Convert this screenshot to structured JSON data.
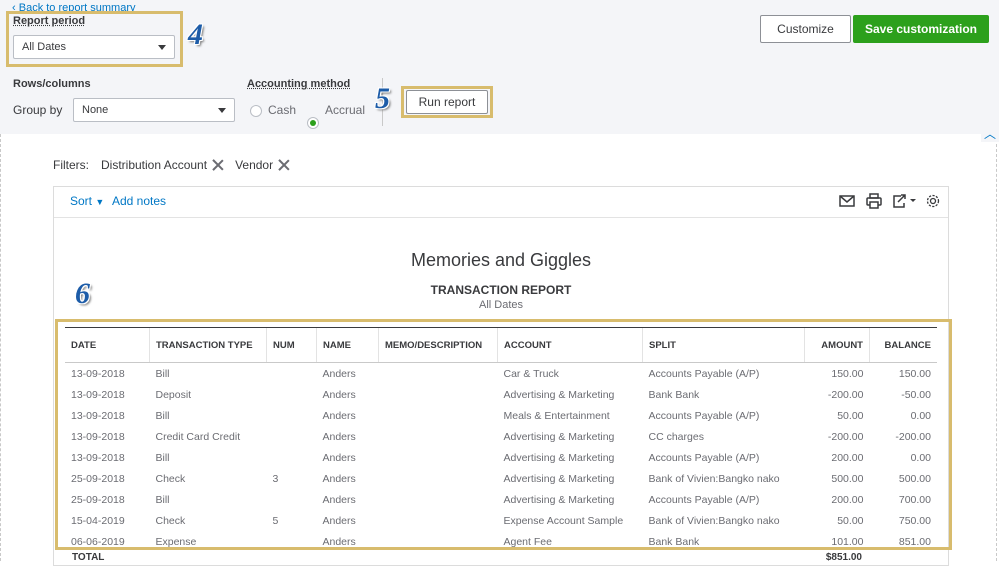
{
  "header": {
    "back_link": "Back to report summary",
    "report_period_label": "Report period",
    "report_period_value": "All Dates",
    "rows_columns_label": "Rows/columns",
    "group_by_label": "Group by",
    "group_by_value": "None",
    "accounting_method_label": "Accounting method",
    "cash_label": "Cash",
    "accrual_label": "Accrual",
    "accounting_method_selected": "Accrual",
    "run_report_label": "Run report",
    "customize_label": "Customize",
    "save_customization_label": "Save customization"
  },
  "callouts": {
    "c4": "4",
    "c5": "5",
    "c6": "6"
  },
  "filters": {
    "label": "Filters:",
    "items": [
      "Distribution Account",
      "Vendor"
    ]
  },
  "toolbar": {
    "sort_label": "Sort",
    "add_notes_label": "Add notes",
    "icons": [
      "email-icon",
      "print-icon",
      "export-icon",
      "settings-icon"
    ]
  },
  "report": {
    "company": "Memories and Giggles",
    "title": "TRANSACTION REPORT",
    "subtitle": "All Dates",
    "columns": [
      "DATE",
      "TRANSACTION TYPE",
      "NUM",
      "NAME",
      "MEMO/DESCRIPTION",
      "ACCOUNT",
      "SPLIT",
      "AMOUNT",
      "BALANCE"
    ],
    "rows": [
      [
        "13-09-2018",
        "Bill",
        "",
        "Anders",
        "",
        "Car & Truck",
        "Accounts Payable (A/P)",
        "150.00",
        "150.00"
      ],
      [
        "13-09-2018",
        "Deposit",
        "",
        "Anders",
        "",
        "Advertising & Marketing",
        "Bank Bank",
        "-200.00",
        "-50.00"
      ],
      [
        "13-09-2018",
        "Bill",
        "",
        "Anders",
        "",
        "Meals & Entertainment",
        "Accounts Payable (A/P)",
        "50.00",
        "0.00"
      ],
      [
        "13-09-2018",
        "Credit Card Credit",
        "",
        "Anders",
        "",
        "Advertising & Marketing",
        "CC charges",
        "-200.00",
        "-200.00"
      ],
      [
        "13-09-2018",
        "Bill",
        "",
        "Anders",
        "",
        "Advertising & Marketing",
        "Accounts Payable (A/P)",
        "200.00",
        "0.00"
      ],
      [
        "25-09-2018",
        "Check",
        "3",
        "Anders",
        "",
        "Advertising & Marketing",
        "Bank of Vivien:Bangko nako",
        "500.00",
        "500.00"
      ],
      [
        "25-09-2018",
        "Bill",
        "",
        "Anders",
        "",
        "Advertising & Marketing",
        "Accounts Payable (A/P)",
        "200.00",
        "700.00"
      ],
      [
        "15-04-2019",
        "Check",
        "5",
        "Anders",
        "",
        "Expense Account Sample",
        "Bank of Vivien:Bangko nako",
        "50.00",
        "750.00"
      ],
      [
        "06-06-2019",
        "Expense",
        "",
        "Anders",
        "",
        "Agent Fee",
        "Bank Bank",
        "101.00",
        "851.00"
      ]
    ],
    "total_label": "TOTAL",
    "total_amount": "$851.00"
  },
  "colors": {
    "accent_green": "#2ca01c",
    "callout_border": "#d8bc6d",
    "link_blue": "#0077c5",
    "callout_text": "#1d5ca8"
  }
}
